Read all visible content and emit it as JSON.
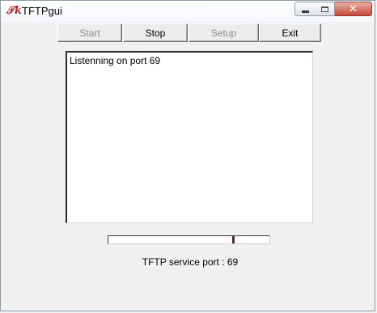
{
  "window": {
    "title": "TFTPgui",
    "icon": "tftpgui-app-icon"
  },
  "title_controls": {
    "minimize_icon": "minimize-icon",
    "maximize_icon": "maximize-icon",
    "close_icon": "close-icon",
    "close_glyph": "✕"
  },
  "toolbar": {
    "start_label": "Start",
    "stop_label": "Stop",
    "setup_label": "Setup",
    "exit_label": "Exit"
  },
  "log": {
    "text": "Listenning on port 69"
  },
  "progress": {
    "marker_fraction": 0.77
  },
  "status": {
    "text": "TFTP service port : 69"
  },
  "colors": {
    "close_button": "#c64a3a",
    "window_bg": "#f0f0f0",
    "progress_marker": "#5a2a20"
  }
}
